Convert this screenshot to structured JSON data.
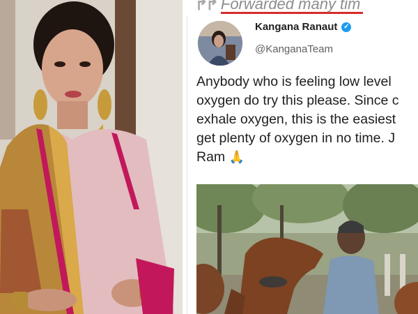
{
  "forwarded_label": {
    "icon": "forward-arrow-icon",
    "text": "Forwarded many tim",
    "underline_color": "#d62c2c"
  },
  "tweet": {
    "author_name": "Kangana Ranaut",
    "verified": true,
    "verified_icon": "verified-badge-icon",
    "handle": "@KanganaTeam",
    "text_lines": [
      "Anybody who is feeling low level",
      "oxygen do try this please. Since c",
      "exhale oxygen, this is the easiest",
      "get plenty of oxygen in no time. J",
      "Ram"
    ],
    "emoji": "🙏",
    "image_description_icon": "tweet-photo"
  },
  "photo": {
    "icon": "portrait-photo"
  },
  "colors": {
    "accent_blue": "#1d9bf0",
    "saree_pink": "#e0b3b8",
    "saree_border": "#c2185b"
  }
}
